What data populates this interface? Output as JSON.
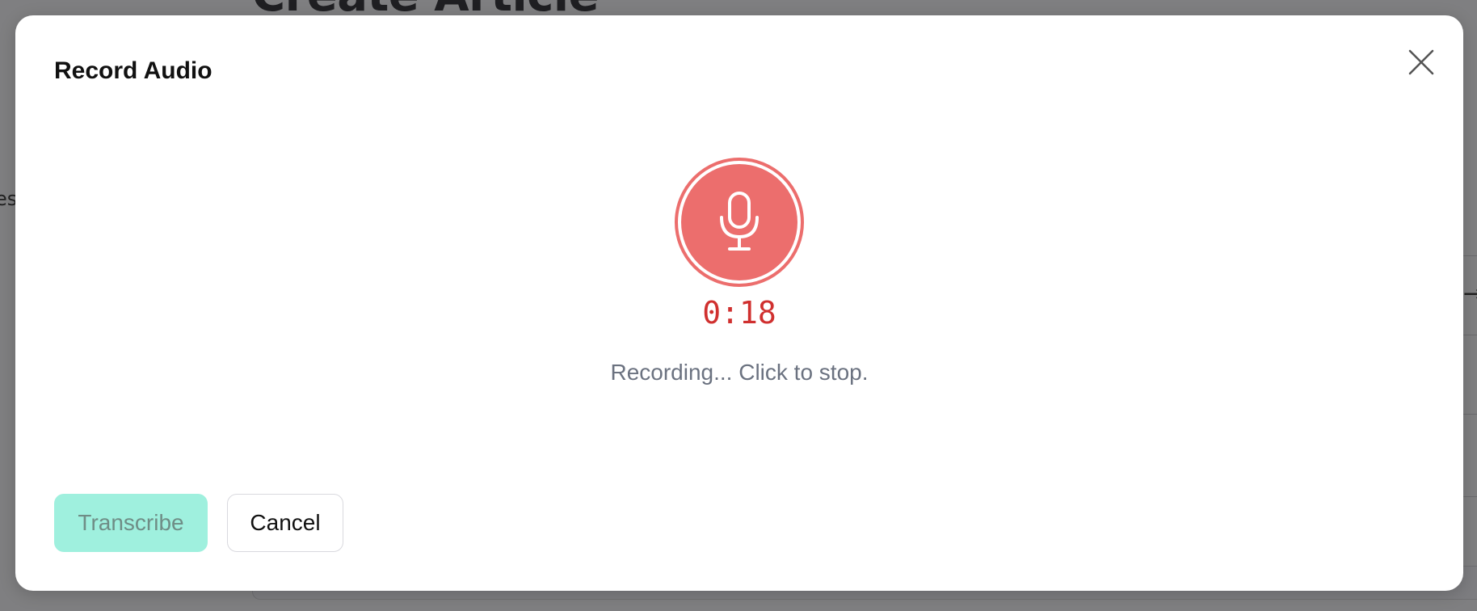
{
  "background": {
    "heading": "Create Article",
    "side_text": "es"
  },
  "modal": {
    "title": "Record Audio",
    "close_icon": "close-icon",
    "mic_icon": "microphone-icon",
    "timer": "0:18",
    "status": "Recording... Click to stop.",
    "buttons": {
      "transcribe_label": "Transcribe",
      "cancel_label": "Cancel"
    }
  },
  "colors": {
    "record_red": "#ec6e6d",
    "timer_red": "#d0302f",
    "transcribe_disabled": "#9ff0de"
  }
}
